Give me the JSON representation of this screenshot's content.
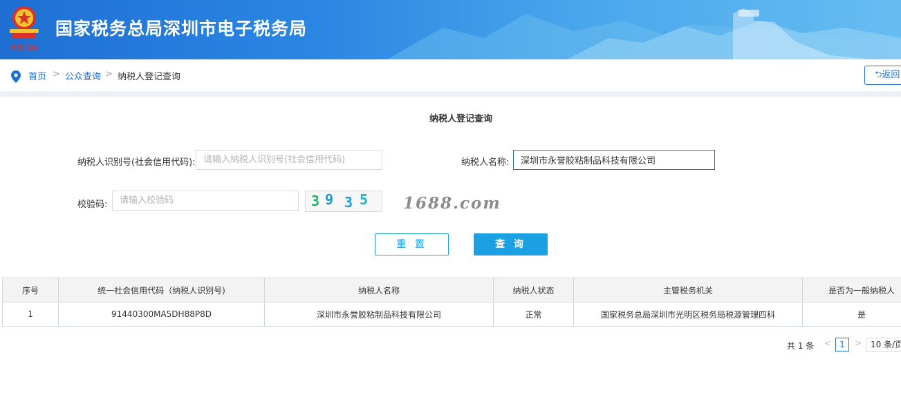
{
  "header": {
    "site_title": "国家税务总局深圳市电子税务局",
    "logo_text": "中国税务",
    "brand_color": "#1f6fd3"
  },
  "breadcrumb": {
    "home": "首页",
    "sep": ">",
    "public_query": "公众查询",
    "current": "纳税人登记查询",
    "back_label": "返回"
  },
  "form": {
    "title": "纳税人登记查询",
    "tax_id_label": "纳税人识别号(社会信用代码):",
    "tax_id_placeholder": "请输入纳税人识别号(社会信用代码)",
    "tax_id_value": "",
    "name_label": "纳税人名称:",
    "name_value": "深圳市永誉胶粘制品科技有限公司",
    "code_label": "校验码:",
    "code_placeholder": "请输入校验码",
    "captcha_digits": [
      "3",
      "9",
      "3",
      "5"
    ],
    "reset_label": "重 置",
    "query_label": "查 询"
  },
  "watermark": "1688.com",
  "table": {
    "headers": [
      "序号",
      "统一社会信用代码（纳税人识别号)",
      "纳税人名称",
      "纳税人状态",
      "主管税务机关",
      "是否为一般纳税人"
    ],
    "rows": [
      [
        "1",
        "91440300MA5DH88P8D",
        "深圳市永誉胶粘制品科技有限公司",
        "正常",
        "国家税务总局深圳市光明区税务局税源管理四科",
        "是"
      ]
    ]
  },
  "pagination": {
    "total": "共 1 条",
    "prev": "<",
    "current_page": "1",
    "next": ">",
    "page_size": "10 条/页"
  }
}
